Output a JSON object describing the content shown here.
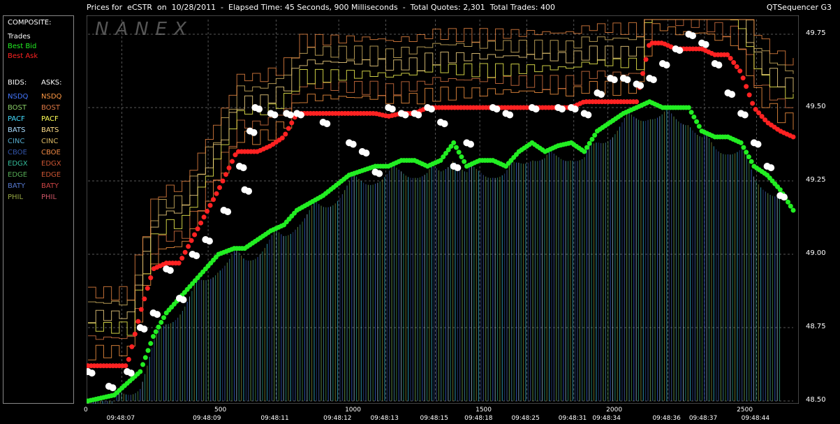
{
  "title": {
    "text": "Prices for  eCSTR  on  10/28/2011  -  Elapsed Time: 45 Seconds, 900 Milliseconds  -  Total Quotes: 2,301  Total Trades: 400",
    "app": "QTSequencer G3"
  },
  "watermark": "NANEX",
  "legend": {
    "composite_heading": "COMPOSITE:",
    "composite": [
      {
        "label": "Trades",
        "color": "#ffffff"
      },
      {
        "label": "Best Bid",
        "color": "#22ee22"
      },
      {
        "label": "Best Ask",
        "color": "#ff2222"
      }
    ],
    "bids_heading": "BIDS:",
    "asks_heading": "ASKS:",
    "exchanges": [
      {
        "bid": "NSDQ",
        "ask": "NSDQ",
        "bid_color": "#4477ff",
        "ask_color": "#ff9944"
      },
      {
        "bid": "BOST",
        "ask": "BOST",
        "bid_color": "#88cc66",
        "ask_color": "#dd7744"
      },
      {
        "bid": "PACF",
        "ask": "PACF",
        "bid_color": "#44ddff",
        "ask_color": "#ffff55"
      },
      {
        "bid": "BATS",
        "ask": "BATS",
        "bid_color": "#aaddff",
        "ask_color": "#ffdd88"
      },
      {
        "bid": "CINC",
        "ask": "CINC",
        "bid_color": "#55aacc",
        "ask_color": "#ddbb66"
      },
      {
        "bid": "CBOE",
        "ask": "CBOE",
        "bid_color": "#3355aa",
        "ask_color": "#ee8844"
      },
      {
        "bid": "EDGX",
        "ask": "EDGX",
        "bid_color": "#33bb99",
        "ask_color": "#cc5533"
      },
      {
        "bid": "EDGE",
        "ask": "EDGE",
        "bid_color": "#55aa55",
        "ask_color": "#cc5533"
      },
      {
        "bid": "BATY",
        "ask": "BATY",
        "bid_color": "#5577cc",
        "ask_color": "#cc4444"
      },
      {
        "bid": "PHIL",
        "ask": "PHIL",
        "bid_color": "#99aa44",
        "ask_color": "#cc5566"
      }
    ]
  },
  "chart_data": {
    "type": "scatter",
    "y_ticks": [
      "49.75",
      "49.50",
      "49.25",
      "49.00",
      "48.75",
      "48.50"
    ],
    "ylim": [
      48.5,
      49.8
    ],
    "x_ticks": [
      "0",
      "500",
      "1000",
      "1500",
      "2000",
      "2500"
    ],
    "xlim": [
      0,
      2700
    ],
    "time_labels": [
      {
        "seq": 130,
        "label": "09:48:07"
      },
      {
        "seq": 460,
        "label": "09:48:09"
      },
      {
        "seq": 720,
        "label": "09:48:11"
      },
      {
        "seq": 960,
        "label": "09:48:12"
      },
      {
        "seq": 1140,
        "label": "09:48:13"
      },
      {
        "seq": 1330,
        "label": "09:48:15"
      },
      {
        "seq": 1500,
        "label": "09:48:18"
      },
      {
        "seq": 1680,
        "label": "09:48:25"
      },
      {
        "seq": 1860,
        "label": "09:48:31"
      },
      {
        "seq": 1990,
        "label": "09:48:34"
      },
      {
        "seq": 2220,
        "label": "09:48:36"
      },
      {
        "seq": 2360,
        "label": "09:48:37"
      },
      {
        "seq": 2560,
        "label": "09:48:44"
      }
    ],
    "grid": true,
    "series": [
      {
        "name": "Best Bid",
        "color": "#22ee22",
        "x": [
          0,
          100,
          200,
          250,
          300,
          350,
          450,
          500,
          560,
          600,
          650,
          700,
          750,
          800,
          900,
          1000,
          1100,
          1150,
          1200,
          1250,
          1300,
          1350,
          1400,
          1450,
          1500,
          1550,
          1600,
          1650,
          1700,
          1750,
          1800,
          1850,
          1900,
          1950,
          2000,
          2050,
          2100,
          2150,
          2200,
          2250,
          2300,
          2350,
          2400,
          2450,
          2500,
          2550,
          2600,
          2650,
          2700
        ],
        "y": [
          48.5,
          48.52,
          48.6,
          48.72,
          48.8,
          48.85,
          48.95,
          49.0,
          49.02,
          49.02,
          49.05,
          49.08,
          49.1,
          49.15,
          49.2,
          49.27,
          49.3,
          49.3,
          49.32,
          49.32,
          49.3,
          49.32,
          49.38,
          49.3,
          49.32,
          49.32,
          49.3,
          49.35,
          49.38,
          49.35,
          49.37,
          49.38,
          49.35,
          49.42,
          49.45,
          49.48,
          49.5,
          49.52,
          49.5,
          49.5,
          49.5,
          49.42,
          49.4,
          49.4,
          49.38,
          49.3,
          49.27,
          49.22,
          49.15
        ]
      },
      {
        "name": "Best Ask",
        "color": "#ff2222",
        "x": [
          0,
          150,
          200,
          250,
          300,
          350,
          500,
          570,
          600,
          650,
          700,
          750,
          800,
          950,
          1000,
          1100,
          1150,
          1200,
          1250,
          1300,
          1400,
          1500,
          1600,
          1700,
          1750,
          1800,
          1850,
          1900,
          2000,
          2100,
          2150,
          2200,
          2250,
          2300,
          2350,
          2400,
          2450,
          2500,
          2550,
          2600,
          2650,
          2700
        ],
        "y": [
          48.62,
          48.62,
          48.8,
          48.95,
          48.97,
          48.97,
          49.22,
          49.35,
          49.35,
          49.35,
          49.37,
          49.4,
          49.48,
          49.48,
          49.48,
          49.48,
          49.47,
          49.48,
          49.48,
          49.5,
          49.5,
          49.5,
          49.5,
          49.5,
          49.5,
          49.5,
          49.5,
          49.52,
          49.52,
          49.52,
          49.72,
          49.72,
          49.7,
          49.7,
          49.7,
          49.68,
          49.68,
          49.62,
          49.5,
          49.45,
          49.42,
          49.4
        ]
      },
      {
        "name": "Trades",
        "color": "#ffffff",
        "x": [
          0,
          80,
          150,
          200,
          250,
          300,
          350,
          400,
          450,
          520,
          580,
          600,
          620,
          640,
          700,
          760,
          800,
          900,
          1000,
          1050,
          1100,
          1150,
          1200,
          1250,
          1300,
          1350,
          1400,
          1450,
          1550,
          1600,
          1700,
          1800,
          1850,
          1900,
          1950,
          2000,
          2050,
          2100,
          2150,
          2200,
          2250,
          2300,
          2350,
          2400,
          2450,
          2500,
          2550,
          2600,
          2650
        ],
        "y": [
          48.6,
          48.55,
          48.6,
          48.75,
          48.8,
          48.95,
          48.85,
          49.0,
          49.05,
          49.15,
          49.3,
          49.22,
          49.42,
          49.5,
          49.48,
          49.48,
          49.48,
          49.45,
          49.38,
          49.35,
          49.28,
          49.5,
          49.48,
          49.48,
          49.5,
          49.45,
          49.3,
          49.38,
          49.5,
          49.48,
          49.5,
          49.5,
          49.5,
          49.48,
          49.55,
          49.6,
          49.6,
          49.58,
          49.6,
          49.65,
          49.7,
          49.75,
          49.72,
          49.65,
          49.55,
          49.48,
          49.38,
          49.3,
          49.2
        ]
      }
    ]
  }
}
